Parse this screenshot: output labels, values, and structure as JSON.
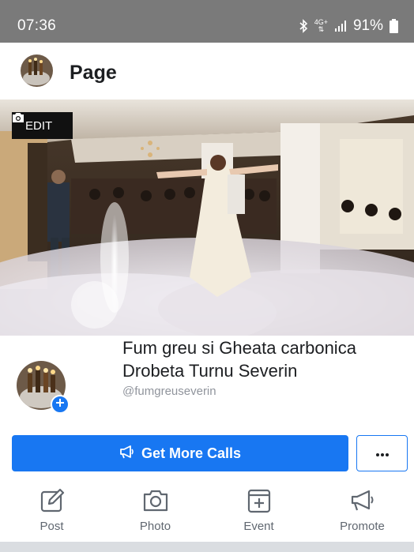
{
  "status_bar": {
    "time": "07:36",
    "network": "4G+",
    "battery": "91%",
    "icons": [
      "bluetooth-icon",
      "data-arrows-icon",
      "signal-icon",
      "battery-icon"
    ]
  },
  "header": {
    "title": "Page",
    "avatar_icon": "page-avatar"
  },
  "cover": {
    "edit_label": "EDIT",
    "edit_icon": "camera-icon"
  },
  "profile": {
    "name": "Fum greu si Gheata carbonica Drobeta Turnu Severin",
    "handle": "@fumgreuseverin",
    "add_icon": "plus-icon"
  },
  "cta": {
    "label": "Get More Calls",
    "icon": "megaphone-icon",
    "more_icon": "ellipsis-icon"
  },
  "actions": [
    {
      "label": "Post",
      "icon": "edit-icon"
    },
    {
      "label": "Photo",
      "icon": "camera-icon"
    },
    {
      "label": "Event",
      "icon": "calendar-plus-icon"
    },
    {
      "label": "Promote",
      "icon": "megaphone-icon"
    }
  ],
  "colors": {
    "accent": "#1877f2",
    "status_bar": "#7a7a7a",
    "muted_text": "#606770"
  }
}
